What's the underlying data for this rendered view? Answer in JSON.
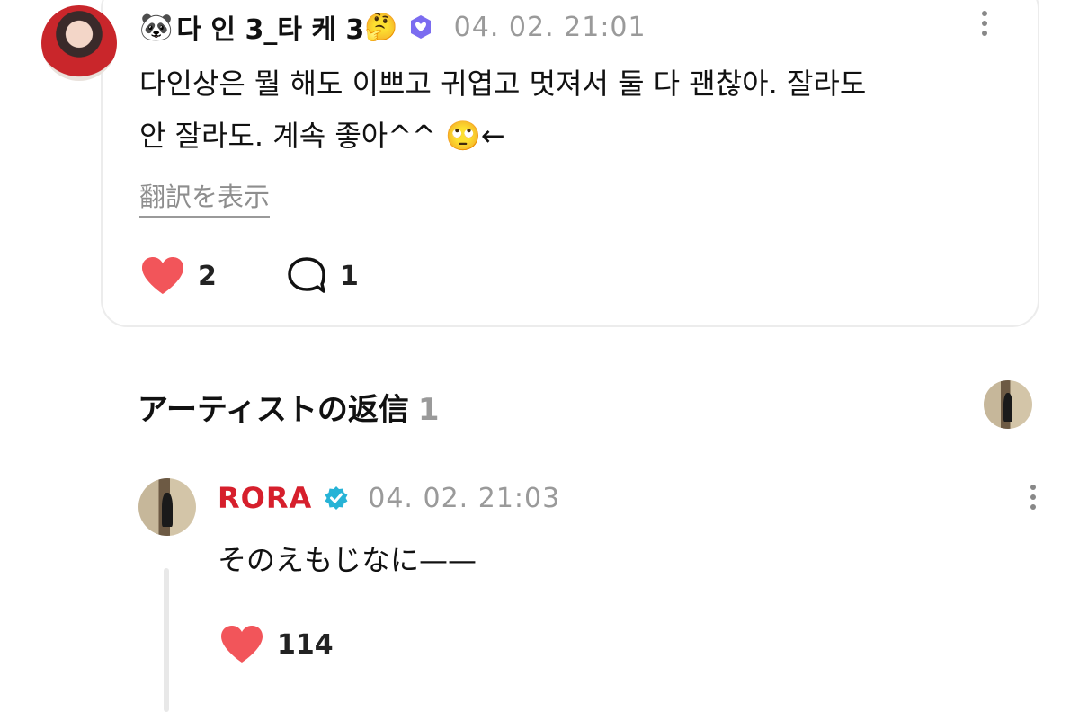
{
  "comment": {
    "username": "다 인 3_타 케 3",
    "emoji_prefix": "🐼",
    "emoji_suffix": "🤔",
    "timestamp": "04. 02. 21:01",
    "text_line1": "다인상은 뭘 해도 이쁘고 귀엽고 멋져서 둘 다 괜찮아. 잘라도",
    "text_line2": "안 잘라도. 계속 좋아^^ 🙄←",
    "translate_label": "翻訳を表示",
    "like_count": "2",
    "reply_count": "1"
  },
  "artist_section": {
    "title": "アーティストの返信",
    "count": "1"
  },
  "reply": {
    "name": "RORA",
    "timestamp": "04. 02. 21:03",
    "text": "そのえもじなに——",
    "like_count": "114"
  },
  "colors": {
    "like_heart": "#f2555a",
    "verified_badge": "#27b3d6",
    "user_badge": "#7b6cf0",
    "artist_name": "#d61f2c",
    "muted_text": "#9a9a9a"
  },
  "icons": [
    "heart-icon",
    "speech-bubble-icon",
    "verified-badge-icon",
    "more-options-icon"
  ]
}
